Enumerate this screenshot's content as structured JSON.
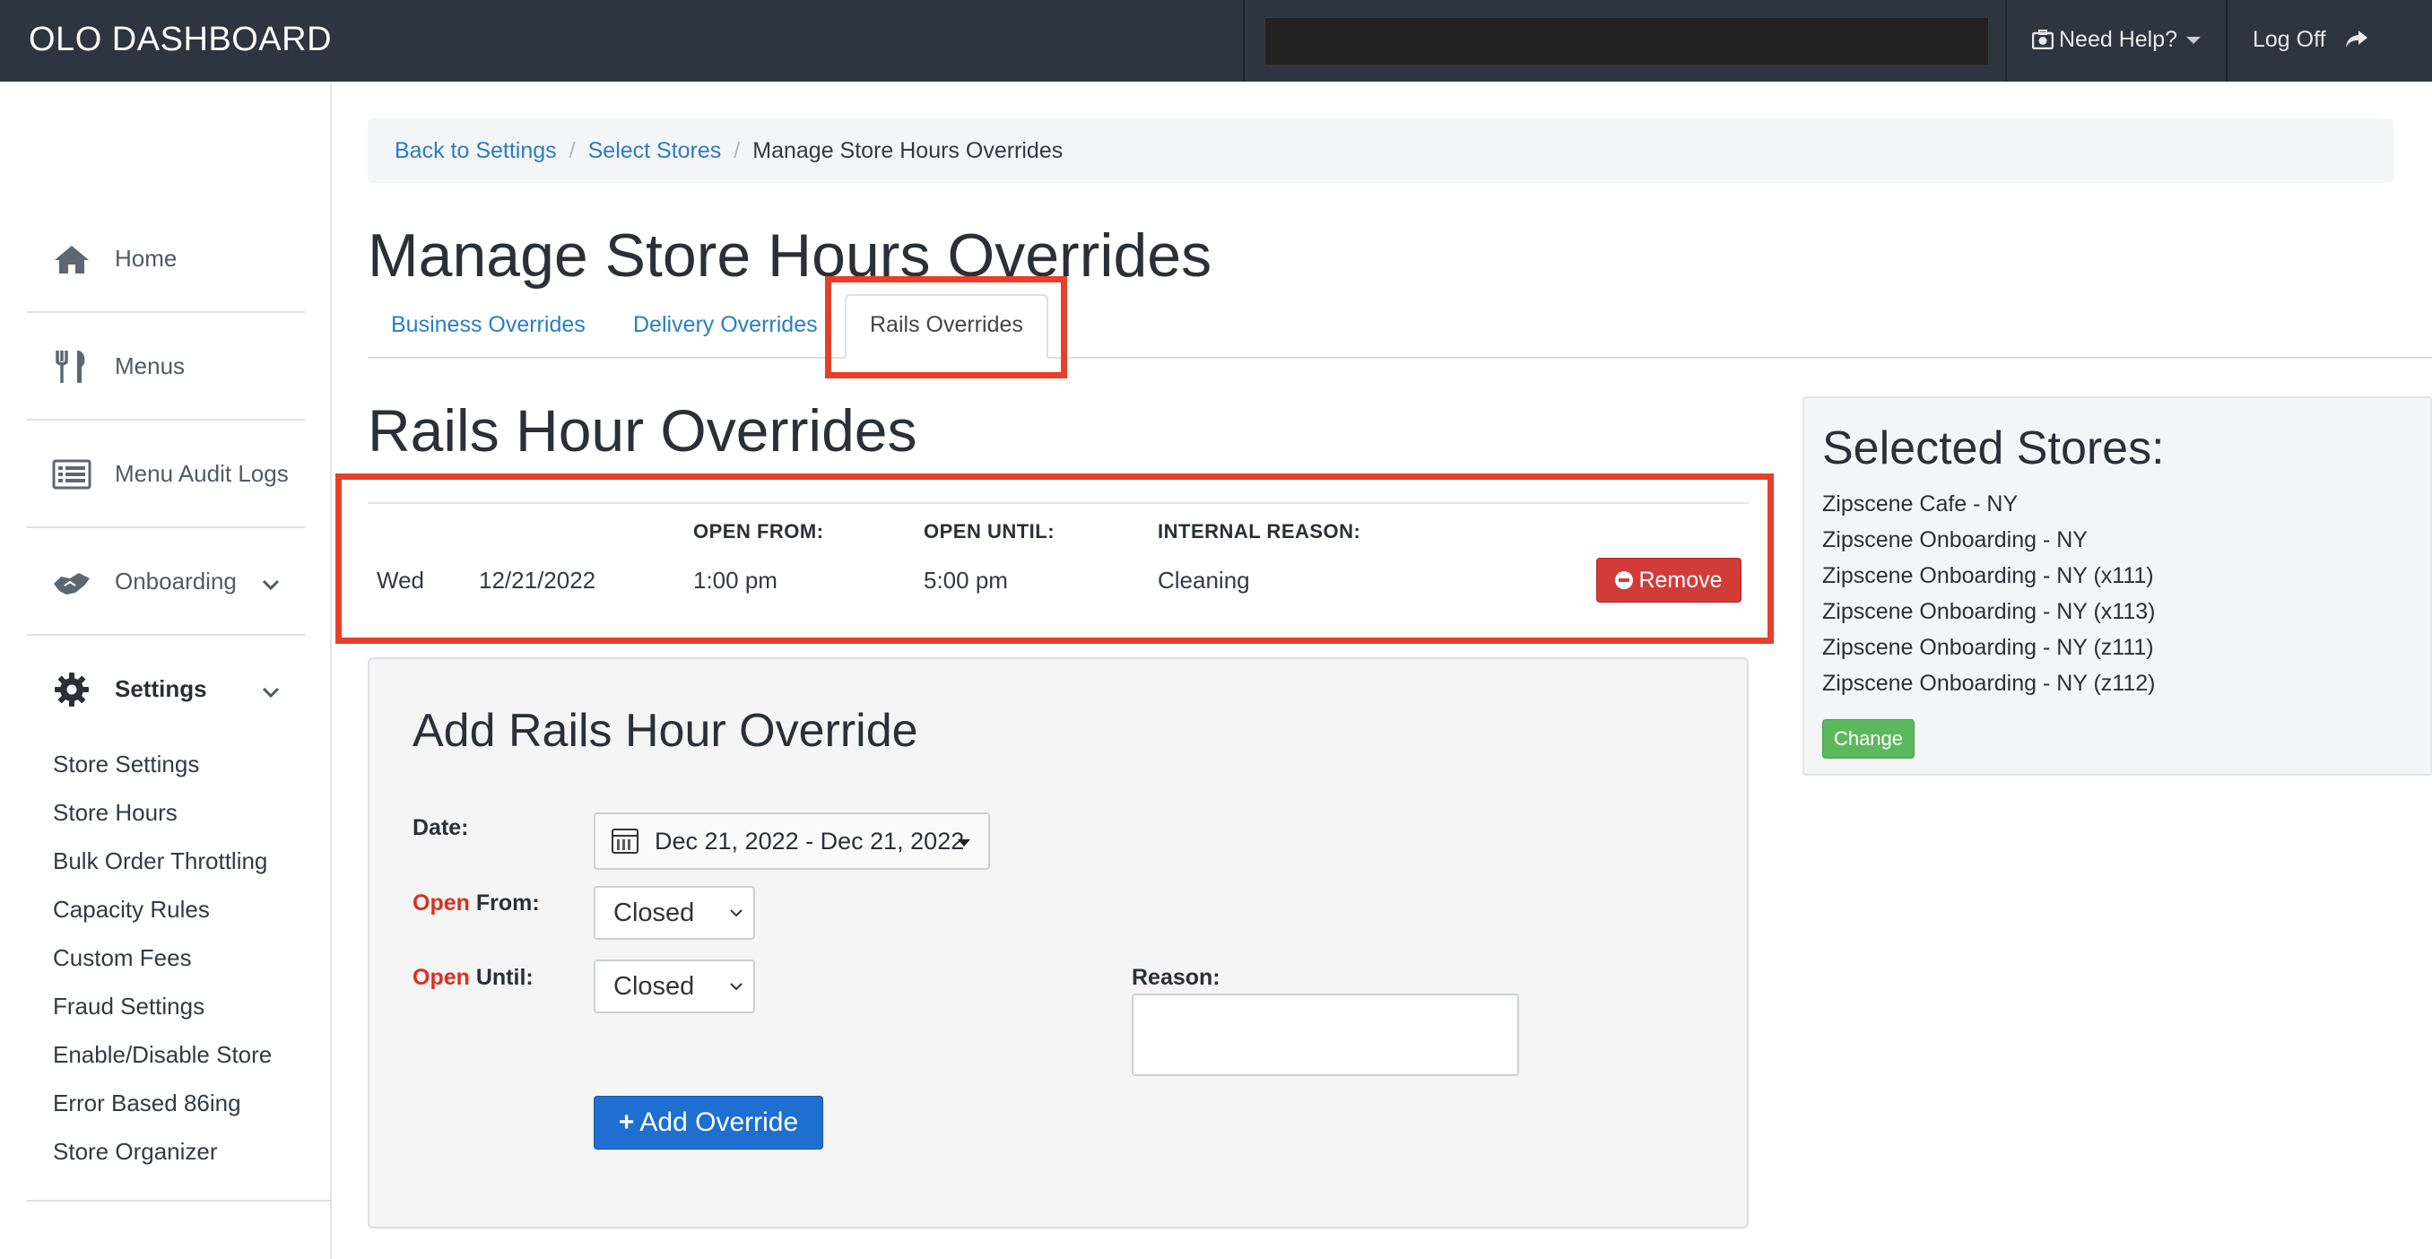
{
  "topbar": {
    "brand": "OLO DASHBOARD",
    "need_help": "Need Help?",
    "log_off": "Log Off"
  },
  "sidebar": {
    "items": [
      {
        "label": "Home",
        "icon": "home-icon"
      },
      {
        "label": "Menus",
        "icon": "fork-knife-icon"
      },
      {
        "label": "Menu Audit Logs",
        "icon": "list-icon"
      },
      {
        "label": "Onboarding",
        "icon": "handshake-icon"
      },
      {
        "label": "Settings",
        "icon": "gear-icon"
      }
    ],
    "settings_links": [
      "Store Settings",
      "Store Hours",
      "Bulk Order Throttling",
      "Capacity Rules",
      "Custom Fees",
      "Fraud Settings",
      "Enable/Disable Store",
      "Error Based 86ing",
      "Store Organizer"
    ]
  },
  "breadcrumb": {
    "back": "Back to Settings",
    "select": "Select Stores",
    "current": "Manage Store Hours Overrides",
    "divider": "/"
  },
  "page": {
    "title": "Manage Store Hours Overrides",
    "tabs": [
      "Business Overrides",
      "Delivery Overrides",
      "Rails Overrides"
    ],
    "section_title": "Rails Hour Overrides"
  },
  "overrides": {
    "headers": {
      "open_from": "OPEN FROM:",
      "open_until": "OPEN UNTIL:",
      "reason": "INTERNAL REASON:"
    },
    "rows": [
      {
        "day": "Wed",
        "date": "12/21/2022",
        "open_from": "1:00 pm",
        "open_until": "5:00 pm",
        "reason": "Cleaning",
        "remove": "Remove"
      }
    ]
  },
  "add_form": {
    "title": "Add Rails Hour Override",
    "date_label": "Date:",
    "date_value": "Dec 21, 2022 - Dec 21, 2022",
    "open_word": "Open",
    "from_word": "From:",
    "until_word": "Until:",
    "open_from_value": "Closed",
    "open_until_value": "Closed",
    "reason_label": "Reason:",
    "reason_value": "",
    "add_button": "Add Override"
  },
  "selected_stores": {
    "title": "Selected Stores:",
    "stores": [
      "Zipscene Cafe - NY",
      "Zipscene Onboarding - NY",
      "Zipscene Onboarding - NY (x111)",
      "Zipscene Onboarding - NY (x113)",
      "Zipscene Onboarding - NY (z111)",
      "Zipscene Onboarding - NY (z112)"
    ],
    "change": "Change"
  },
  "colors": {
    "topbar": "#2c3540",
    "link": "#2a7ec0",
    "danger": "#d23b38",
    "primary": "#1e6fd0",
    "success": "#5cb85c",
    "highlight": "#e5402b"
  }
}
